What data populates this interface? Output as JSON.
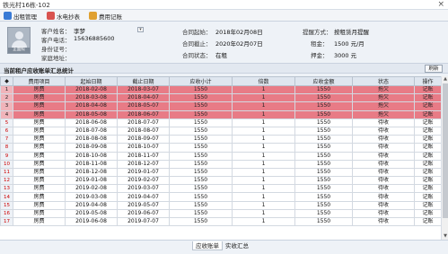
{
  "window": {
    "title": "铁光村16栋-102",
    "close_glyph": "×"
  },
  "toolbar": {
    "items": [
      {
        "label": "出租管理",
        "icon": "rent-manage-icon",
        "color": "#3a7bd5"
      },
      {
        "label": "水电抄表",
        "icon": "meter-reading-icon",
        "color": "#d9534f"
      },
      {
        "label": "费用记账",
        "icon": "bill-record-icon",
        "color": "#e0a030"
      }
    ]
  },
  "tenant": {
    "name_label": "客户姓名：",
    "name": "李梦",
    "phone_label": "客户电话：",
    "phone": "15636885600",
    "id_label": "身份证号：",
    "id": "",
    "address_label": "家庭地址：",
    "address": "",
    "avatar_caption": "正面照"
  },
  "contract": {
    "start_label": "合同起始：",
    "start": "2018年02月08日",
    "end_label": "合同截止：",
    "end": "2020年02月07日",
    "status_label": "合同状态：",
    "status": "在租",
    "reminder_label": "提醒方式：",
    "reminder": "按租赁月提醒",
    "rent_label": "租金：",
    "rent": "1500 元/月",
    "deposit_label": "押金：",
    "deposit": "3000 元"
  },
  "section": {
    "title": "当前租户应收账单汇总统计",
    "refresh_label": "刷新"
  },
  "table": {
    "headers": [
      "费用项目",
      "起始日期",
      "截止日期",
      "应收小计",
      "倍数",
      "应收金额",
      "状态",
      "操作"
    ],
    "rows": [
      {
        "n": "1",
        "item": "房费",
        "start": "2018-02-08",
        "end": "2018-03-07",
        "sub": "1550",
        "mult": "1",
        "amt": "1550",
        "status": "拖欠",
        "op": "记账",
        "overdue": true
      },
      {
        "n": "2",
        "item": "房费",
        "start": "2018-03-08",
        "end": "2018-04-07",
        "sub": "1550",
        "mult": "1",
        "amt": "1550",
        "status": "拖欠",
        "op": "记账",
        "overdue": true
      },
      {
        "n": "3",
        "item": "房费",
        "start": "2018-04-08",
        "end": "2018-05-07",
        "sub": "1550",
        "mult": "1",
        "amt": "1550",
        "status": "拖欠",
        "op": "记账",
        "overdue": true
      },
      {
        "n": "4",
        "item": "房费",
        "start": "2018-05-08",
        "end": "2018-06-07",
        "sub": "1550",
        "mult": "1",
        "amt": "1550",
        "status": "拖欠",
        "op": "记账",
        "overdue": true
      },
      {
        "n": "5",
        "item": "房费",
        "start": "2018-06-08",
        "end": "2018-07-07",
        "sub": "1550",
        "mult": "1",
        "amt": "1550",
        "status": "待收",
        "op": "记账",
        "overdue": false
      },
      {
        "n": "6",
        "item": "房费",
        "start": "2018-07-08",
        "end": "2018-08-07",
        "sub": "1550",
        "mult": "1",
        "amt": "1550",
        "status": "待收",
        "op": "记账",
        "overdue": false
      },
      {
        "n": "7",
        "item": "房费",
        "start": "2018-08-08",
        "end": "2018-09-07",
        "sub": "1550",
        "mult": "1",
        "amt": "1550",
        "status": "待收",
        "op": "记账",
        "overdue": false
      },
      {
        "n": "8",
        "item": "房费",
        "start": "2018-09-08",
        "end": "2018-10-07",
        "sub": "1550",
        "mult": "1",
        "amt": "1550",
        "status": "待收",
        "op": "记账",
        "overdue": false
      },
      {
        "n": "9",
        "item": "房费",
        "start": "2018-10-08",
        "end": "2018-11-07",
        "sub": "1550",
        "mult": "1",
        "amt": "1550",
        "status": "待收",
        "op": "记账",
        "overdue": false
      },
      {
        "n": "10",
        "item": "房费",
        "start": "2018-11-08",
        "end": "2018-12-07",
        "sub": "1550",
        "mult": "1",
        "amt": "1550",
        "status": "待收",
        "op": "记账",
        "overdue": false
      },
      {
        "n": "11",
        "item": "房费",
        "start": "2018-12-08",
        "end": "2019-01-07",
        "sub": "1550",
        "mult": "1",
        "amt": "1550",
        "status": "待收",
        "op": "记账",
        "overdue": false
      },
      {
        "n": "12",
        "item": "房费",
        "start": "2019-01-08",
        "end": "2019-02-07",
        "sub": "1550",
        "mult": "1",
        "amt": "1550",
        "status": "待收",
        "op": "记账",
        "overdue": false
      },
      {
        "n": "13",
        "item": "房费",
        "start": "2019-02-08",
        "end": "2019-03-07",
        "sub": "1550",
        "mult": "1",
        "amt": "1550",
        "status": "待收",
        "op": "记账",
        "overdue": false
      },
      {
        "n": "14",
        "item": "房费",
        "start": "2019-03-08",
        "end": "2019-04-07",
        "sub": "1550",
        "mult": "1",
        "amt": "1550",
        "status": "待收",
        "op": "记账",
        "overdue": false
      },
      {
        "n": "15",
        "item": "房费",
        "start": "2019-04-08",
        "end": "2019-05-07",
        "sub": "1550",
        "mult": "1",
        "amt": "1550",
        "status": "待收",
        "op": "记账",
        "overdue": false
      },
      {
        "n": "16",
        "item": "房费",
        "start": "2019-05-08",
        "end": "2019-06-07",
        "sub": "1550",
        "mult": "1",
        "amt": "1550",
        "status": "待收",
        "op": "记账",
        "overdue": false
      },
      {
        "n": "17",
        "item": "房费",
        "start": "2019-06-08",
        "end": "2019-07-07",
        "sub": "1550",
        "mult": "1",
        "amt": "1550",
        "status": "待收",
        "op": "记账",
        "overdue": false
      }
    ]
  },
  "tabs": [
    {
      "label": "应收账单",
      "active": true
    },
    {
      "label": "实收汇总",
      "active": false
    }
  ],
  "colors": {
    "overdue_row": "#e87b86",
    "header_bg": "#dfe6ef"
  }
}
